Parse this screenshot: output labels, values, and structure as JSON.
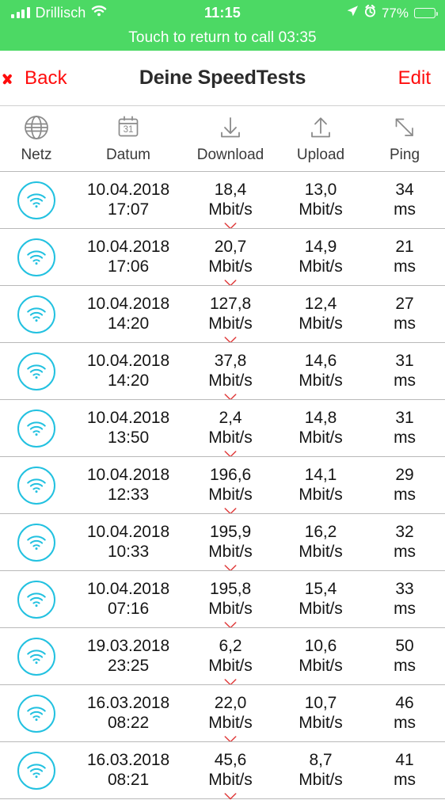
{
  "statusbar": {
    "carrier": "Drillisch",
    "signal_icon": "signal-bars-icon",
    "wifi_icon": "wifi-icon",
    "clock": "11:15",
    "location_icon": "location-arrow-icon",
    "alarm_icon": "alarm-clock-icon",
    "battery_percent": "77%",
    "battery_icon": "battery-icon",
    "battery_level": 77,
    "call_banner": "Touch to return to call 03:35",
    "background_color": "#4CD964"
  },
  "navbar": {
    "back_label": "Back",
    "back_icon": "chevron-left-icon",
    "title": "Deine SpeedTests",
    "edit_label": "Edit",
    "accent_color": "#FF0C0C"
  },
  "table": {
    "columns": [
      {
        "key": "netz",
        "label": "Netz",
        "icon": "globe-icon"
      },
      {
        "key": "datum",
        "label": "Datum",
        "icon": "calendar-icon"
      },
      {
        "key": "download",
        "label": "Download",
        "icon": "download-arrow-icon"
      },
      {
        "key": "upload",
        "label": "Upload",
        "icon": "upload-arrow-icon"
      },
      {
        "key": "ping",
        "label": "Ping",
        "icon": "diagonal-arrows-icon"
      }
    ],
    "unit_speed": "Mbit/s",
    "unit_ping": "ms",
    "network_icon": "wifi-circle-icon",
    "network_icon_color": "#22C1E0",
    "expand_icon": "chevron-down-icon",
    "expand_icon_color": "#E03B3B",
    "rows": [
      {
        "network": "wifi",
        "date": "10.04.2018",
        "time": "17:07",
        "download": "18,4",
        "upload": "13,0",
        "ping": "34"
      },
      {
        "network": "wifi",
        "date": "10.04.2018",
        "time": "17:06",
        "download": "20,7",
        "upload": "14,9",
        "ping": "21"
      },
      {
        "network": "wifi",
        "date": "10.04.2018",
        "time": "14:20",
        "download": "127,8",
        "upload": "12,4",
        "ping": "27"
      },
      {
        "network": "wifi",
        "date": "10.04.2018",
        "time": "14:20",
        "download": "37,8",
        "upload": "14,6",
        "ping": "31"
      },
      {
        "network": "wifi",
        "date": "10.04.2018",
        "time": "13:50",
        "download": "2,4",
        "upload": "14,8",
        "ping": "31"
      },
      {
        "network": "wifi",
        "date": "10.04.2018",
        "time": "12:33",
        "download": "196,6",
        "upload": "14,1",
        "ping": "29"
      },
      {
        "network": "wifi",
        "date": "10.04.2018",
        "time": "10:33",
        "download": "195,9",
        "upload": "16,2",
        "ping": "32"
      },
      {
        "network": "wifi",
        "date": "10.04.2018",
        "time": "07:16",
        "download": "195,8",
        "upload": "15,4",
        "ping": "33"
      },
      {
        "network": "wifi",
        "date": "19.03.2018",
        "time": "23:25",
        "download": "6,2",
        "upload": "10,6",
        "ping": "50"
      },
      {
        "network": "wifi",
        "date": "16.03.2018",
        "time": "08:22",
        "download": "22,0",
        "upload": "10,7",
        "ping": "46"
      },
      {
        "network": "wifi",
        "date": "16.03.2018",
        "time": "08:21",
        "download": "45,6",
        "upload": "8,7",
        "ping": "41"
      }
    ]
  }
}
